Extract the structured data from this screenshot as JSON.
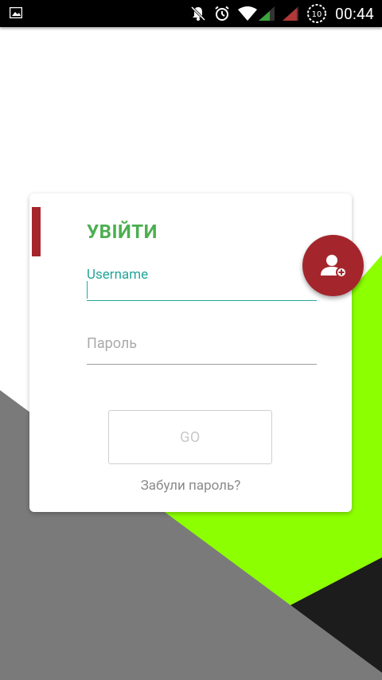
{
  "status_bar": {
    "time": "00:44",
    "alarm_number": "10",
    "icons": [
      "image-icon",
      "notifications-off-icon",
      "alarm-icon",
      "wifi-icon",
      "signal-icon",
      "signal-icon-2",
      "battery-icon"
    ]
  },
  "colors": {
    "accent_red": "#a4262c",
    "title_green": "#4caf50",
    "input_teal": "#26a69a",
    "lime": "#8cff00",
    "gray": "#7a7a7a",
    "dark": "#1c1c1c"
  },
  "login": {
    "title": "УВІЙТИ",
    "username_label": "Username",
    "password_placeholder": "Пароль",
    "go_label": "GO",
    "forgot_password": "Забули пароль?"
  },
  "fab": {
    "icon": "add-user-icon"
  }
}
